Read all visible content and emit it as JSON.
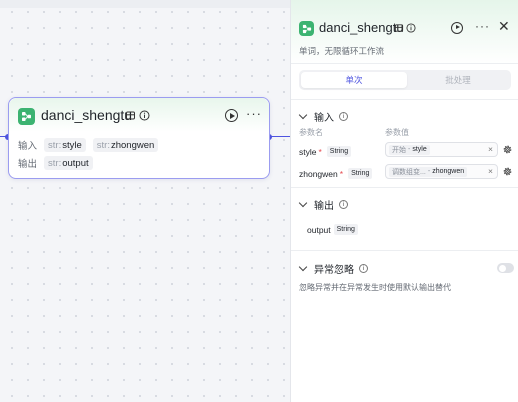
{
  "node": {
    "title": "danci_shengtu",
    "input_label": "输入",
    "output_label": "输出",
    "inputs": [
      {
        "type": "str:",
        "name": "style"
      },
      {
        "type": "str:",
        "name": "zhongwen"
      }
    ],
    "outputs": [
      {
        "type": "str:",
        "name": "output"
      }
    ]
  },
  "panel": {
    "title": "danci_shengtu",
    "description": "单词，无限循环工作流",
    "tabs": {
      "single": "单次",
      "batch": "批处理"
    },
    "input_section": {
      "title": "输入",
      "col_name": "参数名",
      "col_value": "参数值",
      "params": [
        {
          "name": "style",
          "type": "String",
          "source": "开始",
          "ref": "style"
        },
        {
          "name": "zhongwen",
          "type": "String",
          "source": "调数组变...",
          "ref": "zhongwen"
        }
      ]
    },
    "output_section": {
      "title": "输出",
      "items": [
        {
          "name": "output",
          "type": "String"
        }
      ]
    },
    "exception_section": {
      "title": "异常忽略",
      "note": "忽略异常并在异常发生时使用默认输出替代",
      "enabled": false
    }
  },
  "colors": {
    "accent": "#4e54e0",
    "brand_green": "#3cb371",
    "required": "#e5484d"
  }
}
